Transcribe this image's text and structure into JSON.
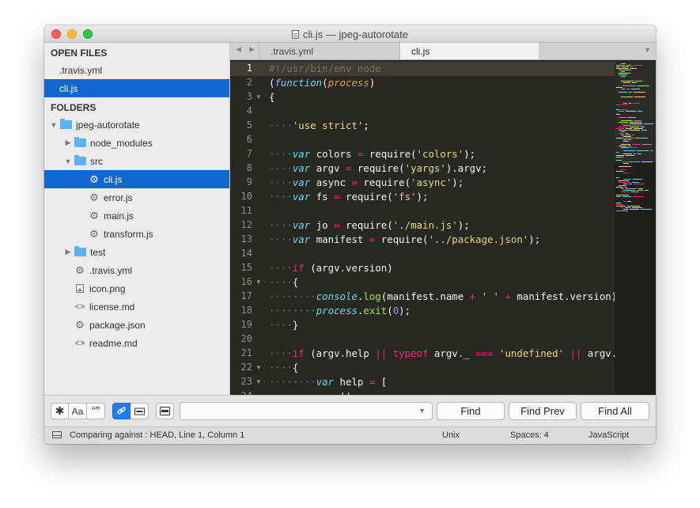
{
  "window": {
    "title": "cli.js — jpeg-autorotate"
  },
  "sidebar": {
    "open_files_title": "OPEN FILES",
    "open_files": [
      {
        "label": ".travis.yml",
        "selected": false
      },
      {
        "label": "cli.js",
        "selected": true
      }
    ],
    "folders_title": "FOLDERS",
    "tree": [
      {
        "label": "jpeg-autorotate",
        "kind": "folder",
        "expanded": true,
        "selected": false
      },
      {
        "label": "node_modules",
        "kind": "folder",
        "expanded": false,
        "selected": false
      },
      {
        "label": "src",
        "kind": "folder",
        "expanded": true,
        "selected": false
      },
      {
        "label": "cli.js",
        "kind": "gear-file",
        "selected": true
      },
      {
        "label": "error.js",
        "kind": "gear-file",
        "selected": false
      },
      {
        "label": "main.js",
        "kind": "gear-file",
        "selected": false
      },
      {
        "label": "transform.js",
        "kind": "gear-file",
        "selected": false
      },
      {
        "label": "test",
        "kind": "folder",
        "expanded": false,
        "selected": false
      },
      {
        "label": ".travis.yml",
        "kind": "gear-file",
        "selected": false
      },
      {
        "label": "icon.png",
        "kind": "image-file",
        "selected": false
      },
      {
        "label": "license.md",
        "kind": "code-file",
        "selected": false
      },
      {
        "label": "package.json",
        "kind": "gear-file",
        "selected": false
      },
      {
        "label": "readme.md",
        "kind": "code-file",
        "selected": false
      }
    ]
  },
  "tabs": [
    {
      "label": ".travis.yml",
      "active": false
    },
    {
      "label": "cli.js",
      "active": true
    }
  ],
  "editor": {
    "current_line": 1,
    "lines": [
      {
        "n": "1",
        "fold": false,
        "tokens": [
          [
            "comment",
            "#!/usr/bin/env node"
          ]
        ]
      },
      {
        "n": "2",
        "fold": false,
        "tokens": [
          [
            "plain",
            "("
          ],
          [
            "storage",
            "function"
          ],
          [
            "plain",
            "("
          ],
          [
            "param",
            "process"
          ],
          [
            "plain",
            ")"
          ]
        ]
      },
      {
        "n": "3",
        "fold": true,
        "tokens": [
          [
            "plain",
            "{"
          ]
        ]
      },
      {
        "n": "4",
        "fold": false,
        "tokens": []
      },
      {
        "n": "5",
        "fold": false,
        "tokens": [
          [
            "guide",
            "····"
          ],
          [
            "string",
            "'use strict'"
          ],
          [
            "plain",
            ";"
          ]
        ]
      },
      {
        "n": "6",
        "fold": false,
        "tokens": []
      },
      {
        "n": "7",
        "fold": false,
        "tokens": [
          [
            "guide",
            "····"
          ],
          [
            "storage",
            "var"
          ],
          [
            "plain",
            " colors "
          ],
          [
            "keyword",
            "="
          ],
          [
            "plain",
            " require("
          ],
          [
            "string",
            "'colors'"
          ],
          [
            "plain",
            ");"
          ]
        ]
      },
      {
        "n": "8",
        "fold": false,
        "tokens": [
          [
            "guide",
            "····"
          ],
          [
            "storage",
            "var"
          ],
          [
            "plain",
            " argv "
          ],
          [
            "keyword",
            "="
          ],
          [
            "plain",
            " require("
          ],
          [
            "string",
            "'yargs'"
          ],
          [
            "plain",
            ").argv;"
          ]
        ]
      },
      {
        "n": "9",
        "fold": false,
        "tokens": [
          [
            "guide",
            "····"
          ],
          [
            "storage",
            "var"
          ],
          [
            "plain",
            " async "
          ],
          [
            "keyword",
            "="
          ],
          [
            "plain",
            " require("
          ],
          [
            "string",
            "'async'"
          ],
          [
            "plain",
            ");"
          ]
        ]
      },
      {
        "n": "10",
        "fold": false,
        "tokens": [
          [
            "guide",
            "····"
          ],
          [
            "storage",
            "var"
          ],
          [
            "plain",
            " fs "
          ],
          [
            "keyword",
            "="
          ],
          [
            "plain",
            " require("
          ],
          [
            "string",
            "'fs'"
          ],
          [
            "plain",
            ");"
          ]
        ]
      },
      {
        "n": "11",
        "fold": false,
        "tokens": []
      },
      {
        "n": "12",
        "fold": false,
        "tokens": [
          [
            "guide",
            "····"
          ],
          [
            "storage",
            "var"
          ],
          [
            "plain",
            " jo "
          ],
          [
            "keyword",
            "="
          ],
          [
            "plain",
            " require("
          ],
          [
            "string",
            "'./main.js'"
          ],
          [
            "plain",
            ");"
          ]
        ]
      },
      {
        "n": "13",
        "fold": false,
        "tokens": [
          [
            "guide",
            "····"
          ],
          [
            "storage",
            "var"
          ],
          [
            "plain",
            " manifest "
          ],
          [
            "keyword",
            "="
          ],
          [
            "plain",
            " require("
          ],
          [
            "string",
            "'../package.json'"
          ],
          [
            "plain",
            ");"
          ]
        ]
      },
      {
        "n": "14",
        "fold": false,
        "tokens": []
      },
      {
        "n": "15",
        "fold": false,
        "tokens": [
          [
            "guide",
            "····"
          ],
          [
            "keyword",
            "if"
          ],
          [
            "plain",
            " (argv.version)"
          ]
        ]
      },
      {
        "n": "16",
        "fold": true,
        "tokens": [
          [
            "guide",
            "····"
          ],
          [
            "plain",
            "{"
          ]
        ]
      },
      {
        "n": "17",
        "fold": false,
        "tokens": [
          [
            "guide",
            "········"
          ],
          [
            "builtin",
            "console"
          ],
          [
            "plain",
            "."
          ],
          [
            "function",
            "log"
          ],
          [
            "plain",
            "(manifest.name "
          ],
          [
            "keyword",
            "+"
          ],
          [
            "plain",
            " "
          ],
          [
            "string",
            "' '"
          ],
          [
            "plain",
            " "
          ],
          [
            "keyword",
            "+"
          ],
          [
            "plain",
            " manifest.version);"
          ]
        ]
      },
      {
        "n": "18",
        "fold": false,
        "tokens": [
          [
            "guide",
            "········"
          ],
          [
            "builtin",
            "process"
          ],
          [
            "plain",
            "."
          ],
          [
            "function",
            "exit"
          ],
          [
            "plain",
            "("
          ],
          [
            "number",
            "0"
          ],
          [
            "plain",
            ");"
          ]
        ]
      },
      {
        "n": "19",
        "fold": false,
        "tokens": [
          [
            "guide",
            "····"
          ],
          [
            "plain",
            "}"
          ]
        ]
      },
      {
        "n": "20",
        "fold": false,
        "tokens": []
      },
      {
        "n": "21",
        "fold": false,
        "tokens": [
          [
            "guide",
            "····"
          ],
          [
            "keyword",
            "if"
          ],
          [
            "plain",
            " (argv.help "
          ],
          [
            "keyword",
            "||"
          ],
          [
            "plain",
            " "
          ],
          [
            "keyword",
            "typeof"
          ],
          [
            "plain",
            " argv._ "
          ],
          [
            "keyword",
            "==="
          ],
          [
            "plain",
            " "
          ],
          [
            "string",
            "'undefined'"
          ],
          [
            "plain",
            " "
          ],
          [
            "keyword",
            "||"
          ],
          [
            "plain",
            " argv._.le"
          ]
        ]
      },
      {
        "n": "22",
        "fold": true,
        "tokens": [
          [
            "guide",
            "····"
          ],
          [
            "plain",
            "{"
          ]
        ]
      },
      {
        "n": "23",
        "fold": true,
        "tokens": [
          [
            "guide",
            "········"
          ],
          [
            "storage",
            "var"
          ],
          [
            "plain",
            " help "
          ],
          [
            "keyword",
            "="
          ],
          [
            "plain",
            " ["
          ]
        ]
      },
      {
        "n": "24",
        "fold": false,
        "tokens": [
          [
            "guide",
            "············"
          ],
          [
            "plain",
            "''"
          ]
        ]
      }
    ]
  },
  "findbar": {
    "options": [
      {
        "name": "regex-toggle",
        "glyph": "*",
        "on": false
      },
      {
        "name": "case-toggle",
        "glyph": "Aa",
        "on": false
      },
      {
        "name": "whole-word-toggle",
        "glyph": "“”",
        "on": false
      },
      {
        "name": "wrap-toggle",
        "glyph": "wrap",
        "on": true
      },
      {
        "name": "in-selection-toggle",
        "glyph": "sel",
        "on": false
      },
      {
        "name": "highlight-toggle",
        "glyph": "hl",
        "on": false
      }
    ],
    "search_value": "",
    "find_label": "Find",
    "find_prev_label": "Find Prev",
    "find_all_label": "Find All"
  },
  "status": {
    "message": "Comparing against : HEAD, Line 1, Column 1",
    "line_endings": "Unix",
    "indentation": "Spaces: 4",
    "syntax": "JavaScript"
  },
  "colors": {
    "selection": "#1266cf",
    "editor_bg": "#272822",
    "keyword": "#f92672",
    "string": "#e6db74",
    "storage": "#66d9ef",
    "comment": "#75715e",
    "number": "#ae81ff",
    "param": "#fd971f",
    "function": "#a6e22e"
  }
}
